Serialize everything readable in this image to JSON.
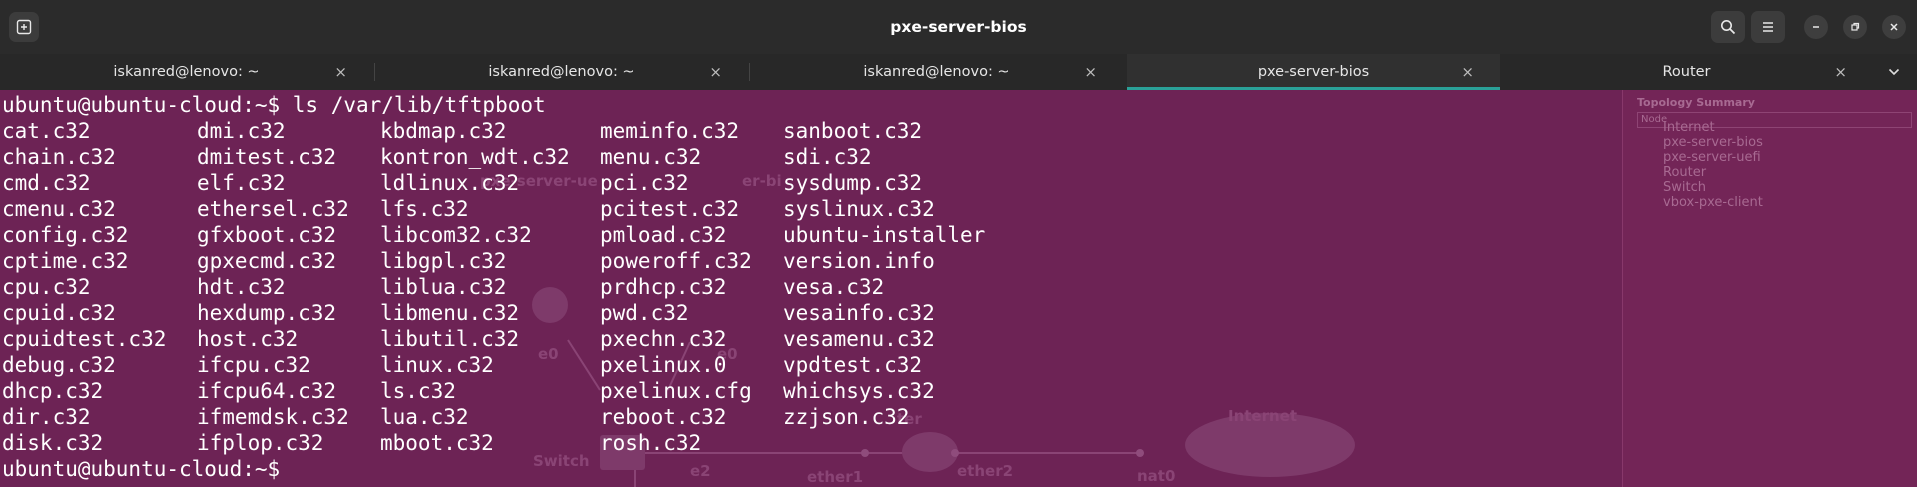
{
  "window": {
    "title": "pxe-server-bios",
    "new_tab_icon": "new-tab-icon",
    "search_icon": "search-icon",
    "menu_icon": "hamburger-menu-icon",
    "minimize_icon": "minimize-icon",
    "maximize_icon": "maximize-icon",
    "close_icon": "close-icon"
  },
  "tabs": [
    {
      "label": "iskanred@lenovo: ~",
      "active": false
    },
    {
      "label": "iskanred@lenovo: ~",
      "active": false
    },
    {
      "label": "iskanred@lenovo: ~",
      "active": false
    },
    {
      "label": "pxe-server-bios",
      "active": true
    },
    {
      "label": "Router",
      "active": false
    }
  ],
  "tab_close_glyph": "×",
  "terminal": {
    "command_line": "ubuntu@ubuntu-cloud:~$ ls /var/lib/tftpboot",
    "final_prompt": "ubuntu@ubuntu-cloud:~$ ",
    "columns": [
      [
        "cat.c32",
        "chain.c32",
        "cmd.c32",
        "cmenu.c32",
        "config.c32",
        "cptime.c32",
        "cpu.c32",
        "cpuid.c32",
        "cpuidtest.c32",
        "debug.c32",
        "dhcp.c32",
        "dir.c32",
        "disk.c32"
      ],
      [
        "dmi.c32",
        "dmitest.c32",
        "elf.c32",
        "ethersel.c32",
        "gfxboot.c32",
        "gpxecmd.c32",
        "hdt.c32",
        "hexdump.c32",
        "host.c32",
        "ifcpu.c32",
        "ifcpu64.c32",
        "ifmemdsk.c32",
        "ifplop.c32"
      ],
      [
        "kbdmap.c32",
        "kontron_wdt.c32",
        "ldlinux.c32",
        "lfs.c32",
        "libcom32.c32",
        "libgpl.c32",
        "liblua.c32",
        "libmenu.c32",
        "libutil.c32",
        "linux.c32",
        "ls.c32",
        "lua.c32",
        "mboot.c32"
      ],
      [
        "meminfo.c32",
        "menu.c32",
        "pci.c32",
        "pcitest.c32",
        "pmload.c32",
        "poweroff.c32",
        "prdhcp.c32",
        "pwd.c32",
        "pxechn.c32",
        "pxelinux.0",
        "pxelinux.cfg",
        "reboot.c32",
        "rosh.c32"
      ],
      [
        "sanboot.c32",
        "sdi.c32",
        "sysdump.c32",
        "syslinux.c32",
        "ubuntu-installer",
        "version.info",
        "vesa.c32",
        "vesainfo.c32",
        "vesamenu.c32",
        "vpdtest.c32",
        "whichsys.c32",
        "zzjson.c32"
      ]
    ]
  },
  "background_app": {
    "panel_title": "Topology Summary",
    "panel_header": "Node",
    "nodes": [
      "Internet",
      "pxe-server-bios",
      "pxe-server-uefi",
      "Router",
      "Switch",
      "vbox-pxe-client"
    ],
    "canvas_labels": {
      "internet": "Internet",
      "switch": "Switch",
      "e0_left": "e0",
      "e0_right": "e0",
      "e2": "e2",
      "ether1": "ether1",
      "ether2": "ether2",
      "nat0": "nat0",
      "server_uefi": "pxe-server-ue",
      "server_bios": "er-bi",
      "router": "ter"
    }
  },
  "colors": {
    "terminal_bg": "#6d2355",
    "active_tab_accent": "#2aa198",
    "titlebar_bg": "#2b2b2b"
  }
}
